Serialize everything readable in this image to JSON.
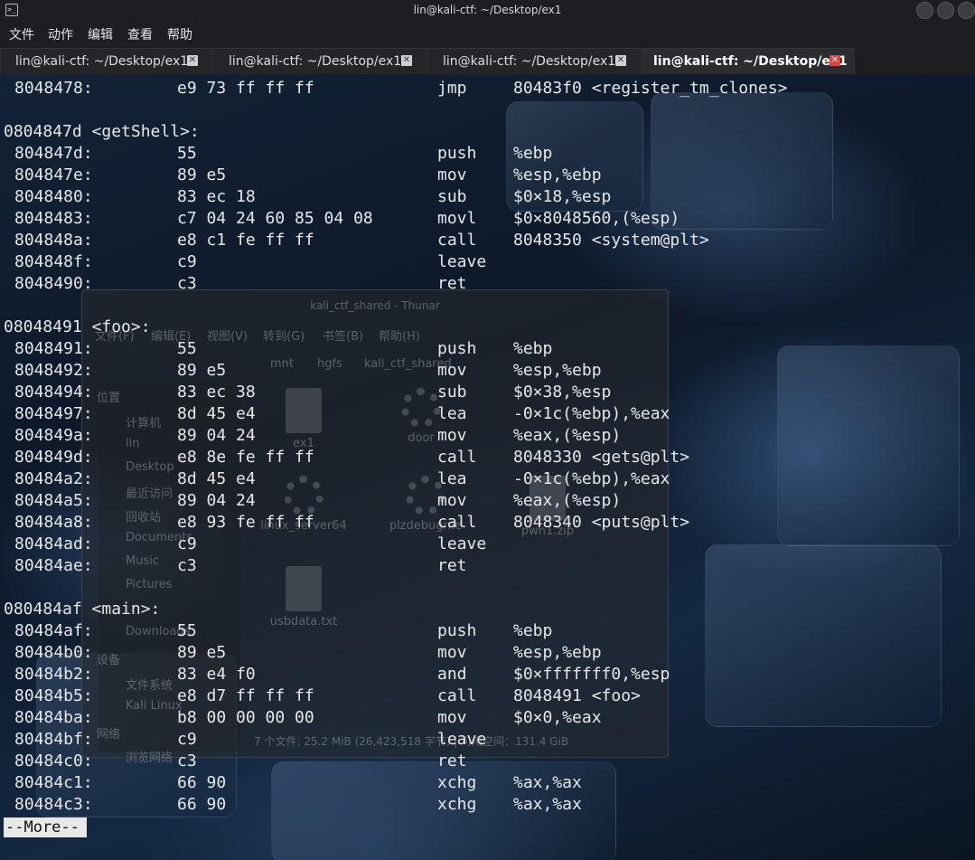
{
  "window": {
    "title": "lin@kali-ctf: ~/Desktop/ex1",
    "app_icon": "terminal-icon"
  },
  "menu": [
    "文件",
    "动作",
    "编辑",
    "查看",
    "帮助"
  ],
  "tabs": [
    {
      "label": "lin@kali-ctf: ~/Desktop/ex1",
      "active": false
    },
    {
      "label": "lin@kali-ctf: ~/Desktop/ex1",
      "active": false
    },
    {
      "label": "lin@kali-ctf: ~/Desktop/ex1",
      "active": false
    },
    {
      "label": "lin@kali-ctf: ~/Desktop/ex1",
      "active": true
    }
  ],
  "thunar": {
    "title": "kali_ctf_shared - Thunar",
    "menu": [
      "文件(F)",
      "编辑(E)",
      "视图(V)",
      "转到(G)",
      "书签(B)",
      "帮助(H)"
    ],
    "path": [
      "mnt",
      "hgfs",
      "kali_ctf_shared"
    ],
    "sidebar": [
      "位置",
      "计算机",
      "lin",
      "Desktop",
      "最近访问",
      "回收站",
      "Documents",
      "Music",
      "Pictures",
      "Downloads",
      "设备",
      "文件系统",
      "Kali Linux",
      "网络",
      "浏览网络"
    ],
    "files": [
      "ex1",
      "door",
      "linux_server64",
      "plzdebugme",
      "pwn1.zip",
      "usbdata.txt"
    ],
    "status": "7 个文件: 25.2 MiB (26,423,518 字节) | 可用空间：131.4 GiB"
  },
  "terminal": {
    "lines": [
      {
        "addr": "8048478:",
        "bytes": "e9 73 ff ff ff",
        "op": "jmp",
        "args": "80483f0 <register_tm_clones>"
      },
      {
        "blank": true
      },
      {
        "header": "0804847d <getShell>:"
      },
      {
        "addr": "804847d:",
        "bytes": "55",
        "op": "push",
        "args": "%ebp"
      },
      {
        "addr": "804847e:",
        "bytes": "89 e5",
        "op": "mov",
        "args": "%esp,%ebp"
      },
      {
        "addr": "8048480:",
        "bytes": "83 ec 18",
        "op": "sub",
        "args": "$0×18,%esp"
      },
      {
        "addr": "8048483:",
        "bytes": "c7 04 24 60 85 04 08",
        "op": "movl",
        "args": "$0×8048560,(%esp)"
      },
      {
        "addr": "804848a:",
        "bytes": "e8 c1 fe ff ff",
        "op": "call",
        "args": "8048350 <system@plt>"
      },
      {
        "addr": "804848f:",
        "bytes": "c9",
        "op": "leave",
        "args": ""
      },
      {
        "addr": "8048490:",
        "bytes": "c3",
        "op": "ret",
        "args": ""
      },
      {
        "blank": true
      },
      {
        "header": "08048491 <foo>:"
      },
      {
        "addr": "8048491:",
        "bytes": "55",
        "op": "push",
        "args": "%ebp"
      },
      {
        "addr": "8048492:",
        "bytes": "89 e5",
        "op": "mov",
        "args": "%esp,%ebp"
      },
      {
        "addr": "8048494:",
        "bytes": "83 ec 38",
        "op": "sub",
        "args": "$0×38,%esp"
      },
      {
        "addr": "8048497:",
        "bytes": "8d 45 e4",
        "op": "lea",
        "args": "-0×1c(%ebp),%eax"
      },
      {
        "addr": "804849a:",
        "bytes": "89 04 24",
        "op": "mov",
        "args": "%eax,(%esp)"
      },
      {
        "addr": "804849d:",
        "bytes": "e8 8e fe ff ff",
        "op": "call",
        "args": "8048330 <gets@plt>"
      },
      {
        "addr": "80484a2:",
        "bytes": "8d 45 e4",
        "op": "lea",
        "args": "-0×1c(%ebp),%eax"
      },
      {
        "addr": "80484a5:",
        "bytes": "89 04 24",
        "op": "mov",
        "args": "%eax,(%esp)"
      },
      {
        "addr": "80484a8:",
        "bytes": "e8 93 fe ff ff",
        "op": "call",
        "args": "8048340 <puts@plt>"
      },
      {
        "addr": "80484ad:",
        "bytes": "c9",
        "op": "leave",
        "args": ""
      },
      {
        "addr": "80484ae:",
        "bytes": "c3",
        "op": "ret",
        "args": ""
      },
      {
        "blank": true
      },
      {
        "header": "080484af <main>:"
      },
      {
        "addr": "80484af:",
        "bytes": "55",
        "op": "push",
        "args": "%ebp"
      },
      {
        "addr": "80484b0:",
        "bytes": "89 e5",
        "op": "mov",
        "args": "%esp,%ebp"
      },
      {
        "addr": "80484b2:",
        "bytes": "83 e4 f0",
        "op": "and",
        "args": "$0×fffffff0,%esp"
      },
      {
        "addr": "80484b5:",
        "bytes": "e8 d7 ff ff ff",
        "op": "call",
        "args": "8048491 <foo>"
      },
      {
        "addr": "80484ba:",
        "bytes": "b8 00 00 00 00",
        "op": "mov",
        "args": "$0×0,%eax"
      },
      {
        "addr": "80484bf:",
        "bytes": "c9",
        "op": "leave",
        "args": ""
      },
      {
        "addr": "80484c0:",
        "bytes": "c3",
        "op": "ret",
        "args": ""
      },
      {
        "addr": "80484c1:",
        "bytes": "66 90",
        "op": "xchg",
        "args": "%ax,%ax"
      },
      {
        "addr": "80484c3:",
        "bytes": "66 90",
        "op": "xchg",
        "args": "%ax,%ax"
      }
    ],
    "pager_prompt": "--More--"
  }
}
